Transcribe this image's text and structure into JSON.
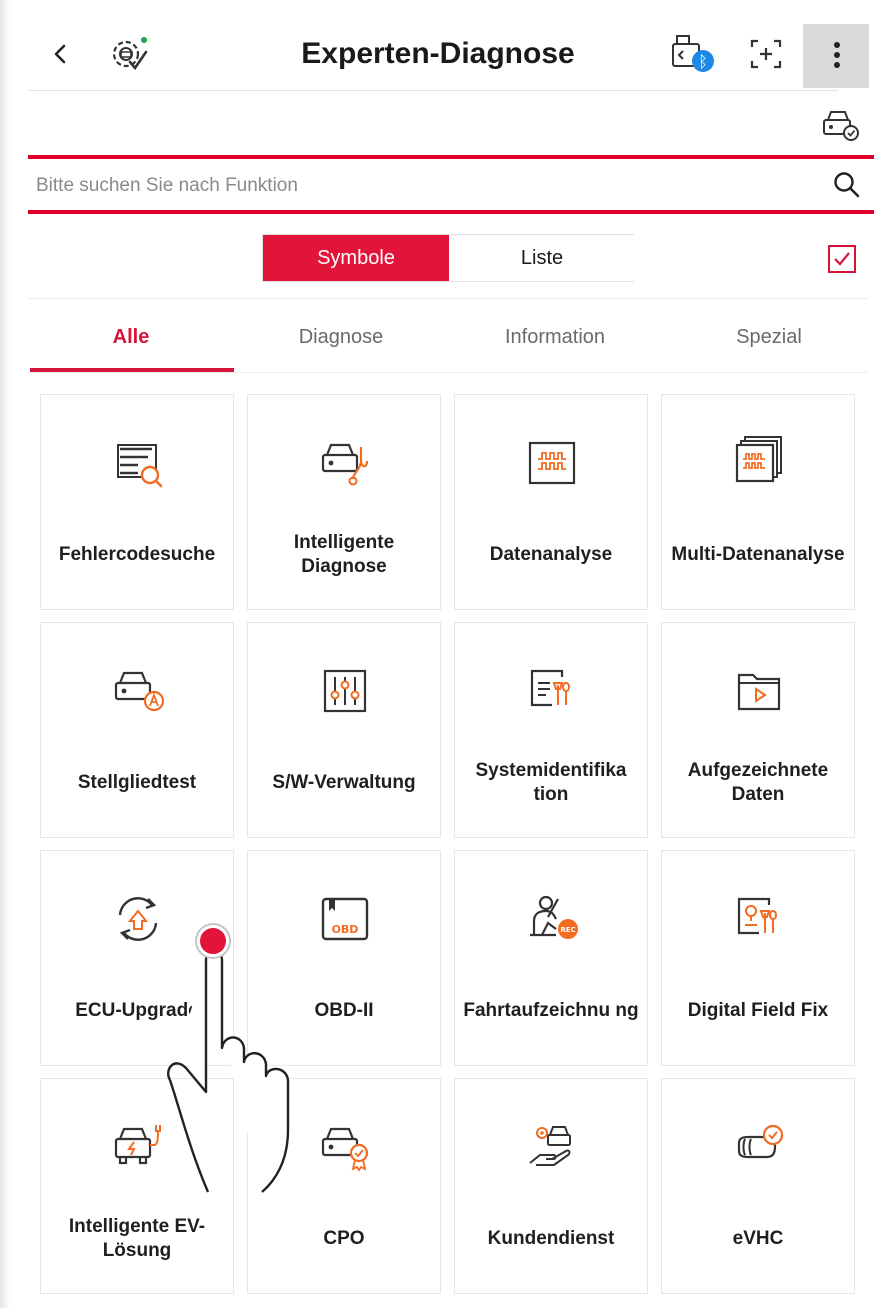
{
  "header": {
    "title": "Experten-Diagnose"
  },
  "search": {
    "placeholder": "Bitte suchen Sie nach Funktion"
  },
  "view_toggle": {
    "symbols_label": "Symbole",
    "list_label": "Liste",
    "selected": "Symbole"
  },
  "tabs": [
    {
      "label": "Alle",
      "active": true
    },
    {
      "label": "Diagnose",
      "active": false
    },
    {
      "label": "Information",
      "active": false
    },
    {
      "label": "Spezial",
      "active": false
    }
  ],
  "functions": [
    {
      "label": "Fehlercodesuche",
      "icon": "code-search-icon"
    },
    {
      "label": "Intelligente Diagnose",
      "icon": "car-stethoscope-icon"
    },
    {
      "label": "Datenanalyse",
      "icon": "waveform-icon"
    },
    {
      "label": "Multi-Datenanalyse",
      "icon": "multi-waveform-icon"
    },
    {
      "label": "Stellgliedtest",
      "icon": "car-actuator-icon"
    },
    {
      "label": "S/W-Verwaltung",
      "icon": "sliders-icon"
    },
    {
      "label": "Systemidentifika tion",
      "icon": "system-id-icon"
    },
    {
      "label": "Aufgezeichnete Daten",
      "icon": "recorded-data-icon"
    },
    {
      "label": "ECU-Upgrade",
      "icon": "ecu-upgrade-icon"
    },
    {
      "label": "OBD-II",
      "icon": "obd-icon"
    },
    {
      "label": "Fahrtaufzeichnu ng",
      "icon": "drive-record-icon"
    },
    {
      "label": "Digital Field Fix",
      "icon": "field-fix-icon"
    },
    {
      "label": "Intelligente EV-Lösung",
      "icon": "ev-car-icon"
    },
    {
      "label": "CPO",
      "icon": "cpo-car-icon"
    },
    {
      "label": "Kundendienst",
      "icon": "customer-service-icon"
    },
    {
      "label": "eVHC",
      "icon": "evhc-icon"
    }
  ],
  "icon_labels": {
    "obd": "OBD",
    "rec": "REC",
    "vci_bt": "ᛒ"
  },
  "colors": {
    "accent": "#e2143a",
    "icon_orange": "#f26b21"
  }
}
